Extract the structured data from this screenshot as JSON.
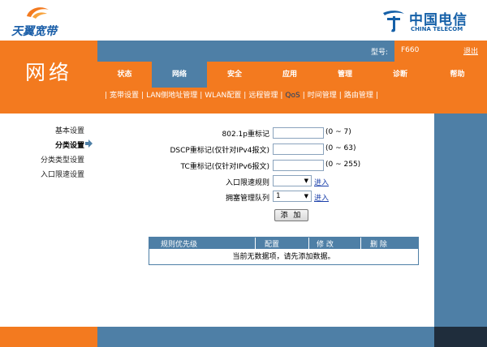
{
  "header": {
    "brand_left": "天翼宽带",
    "brand_right_cn": "中国电信",
    "brand_right_en": "CHINA TELECOM",
    "section_title": "网络",
    "model_label": "型号:",
    "model_value": "F660",
    "logout": "退出"
  },
  "tabs": [
    {
      "label": "状态",
      "active": false
    },
    {
      "label": "网络",
      "active": true
    },
    {
      "label": "安全",
      "active": false
    },
    {
      "label": "应用",
      "active": false
    },
    {
      "label": "管理",
      "active": false
    },
    {
      "label": "诊断",
      "active": false
    },
    {
      "label": "帮助",
      "active": false
    }
  ],
  "subnav": [
    {
      "label": "宽带设置",
      "active": false
    },
    {
      "label": "LAN侧地址管理",
      "active": false
    },
    {
      "label": "WLAN配置",
      "active": false
    },
    {
      "label": "远程管理",
      "active": false
    },
    {
      "label": "QoS",
      "active": true
    },
    {
      "label": "时间管理",
      "active": false
    },
    {
      "label": "路由管理",
      "active": false
    }
  ],
  "left_menu": [
    {
      "label": "基本设置",
      "active": false
    },
    {
      "label": "分类设置",
      "active": true
    },
    {
      "label": "分类类型设置",
      "active": false
    },
    {
      "label": "入口限速设置",
      "active": false
    }
  ],
  "form": {
    "p8021_label": "802.1p重标记",
    "p8021_value": "",
    "p8021_range": "(0 ~ 7)",
    "dscp_label": "DSCP重标记(仅针对IPv4报文)",
    "dscp_value": "",
    "dscp_range": "(0 ~ 63)",
    "tc_label": "TC重标记(仅针对IPv6报文)",
    "tc_value": "",
    "tc_range": "(0 ~ 255)",
    "ingress_label": "入口限速规则",
    "ingress_value": "",
    "ingress_link": "进入",
    "queue_label": "拥塞管理队列",
    "queue_value": "1",
    "queue_link": "进入",
    "add_button": "添 加"
  },
  "table": {
    "columns": [
      "规则优先级",
      "配置",
      "修 改",
      "删 除"
    ],
    "empty_message": "当前无数据项，请先添加数据。"
  },
  "colors": {
    "orange": "#f37a1f",
    "blue": "#4e7fa6",
    "brand_blue": "#1560a8"
  }
}
